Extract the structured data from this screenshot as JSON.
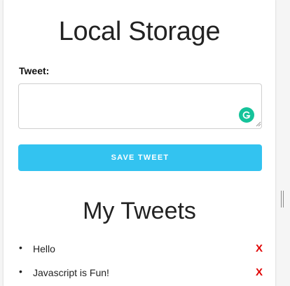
{
  "page": {
    "title": "Local Storage"
  },
  "form": {
    "tweet_label": "Tweet:",
    "tweet_value": "",
    "save_label": "SAVE TWEET"
  },
  "tweets_section": {
    "title": "My Tweets",
    "items": [
      {
        "text": "Hello",
        "remove_label": "X"
      },
      {
        "text": "Javascript is Fun!",
        "remove_label": "X"
      }
    ]
  },
  "icons": {
    "grammarly": "grammarly-icon",
    "resize": "resize-handle-icon",
    "scroll_grip": "scrollbar-grip-icon"
  },
  "colors": {
    "accent": "#33c3f0",
    "remove": "#e00000",
    "grammarly": "#15c39a"
  }
}
